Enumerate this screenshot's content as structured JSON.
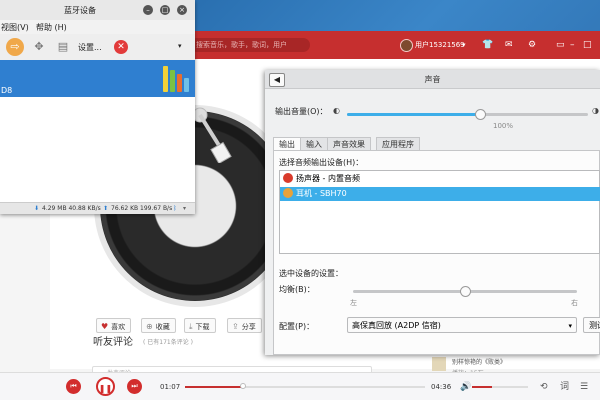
{
  "bluetooth": {
    "title": "蓝牙设备",
    "menu": [
      "视图(V)",
      "帮助 (H)"
    ],
    "toolbar_setup": "设置...",
    "selected_device_tail": "D8",
    "status_down": "4.29 MB 40.88 KB/s",
    "status_up": "76.62 KB 199.67 B/s"
  },
  "music": {
    "search_placeholder": "搜索音乐，歌手，歌词，用户",
    "user_name": "用户15321569",
    "actions": [
      "喜欢",
      "收藏",
      "下载",
      "分享"
    ],
    "comments_title": "听友评论",
    "comments_count": "( 已有171条评论 )",
    "comment_placeholder": "发表评论",
    "similar_title": "别样惊艳的《败类》",
    "similar_sub": "播放：15万",
    "elapsed": "01:07",
    "total": "04:36",
    "progress": 0.24,
    "volume": 0.35
  },
  "sound": {
    "title": "声音",
    "output_volume_label": "输出音量(O)：",
    "volume_percent": 0.55,
    "percent_mark": "100%",
    "tabs": [
      "输出",
      "输入",
      "声音效果",
      "应用程序"
    ],
    "active_tab": 0,
    "device_list_label": "选择音频输出设备(H)：",
    "devices": [
      {
        "name": "扬声器 - 内置音频",
        "icon": "speaker-icon",
        "color": "#d93a2b"
      },
      {
        "name": "耳机 - SBH70",
        "icon": "headphone-icon",
        "color": "#e8a23a"
      }
    ],
    "selected_device": 1,
    "device_settings_label": "选中设备的设置：",
    "balance_label": "均衡(B)：",
    "balance": 0.5,
    "left_label": "左",
    "right_label": "右",
    "profile_label": "配置(P)：",
    "profile_value": "高保真回放 (A2DP 信宿)",
    "test_button": "测试"
  }
}
